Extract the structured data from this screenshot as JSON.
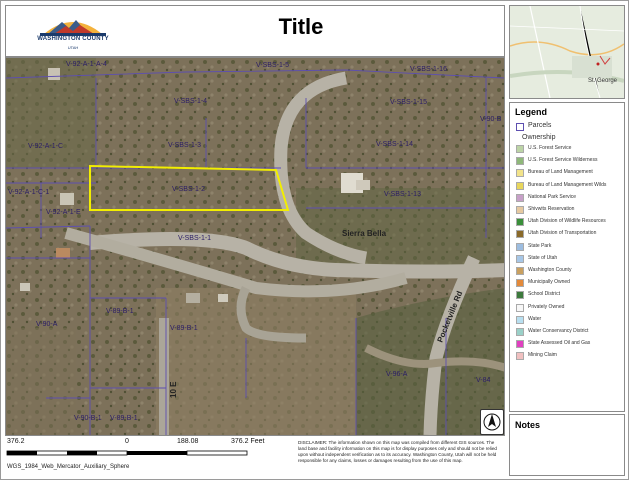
{
  "header": {
    "title": "Title",
    "logo_name": "WASHINGTON COUNTY",
    "logo_sub": "UTAH"
  },
  "map": {
    "parcel_labels": [
      {
        "id": "p1",
        "text": "V-92-A-1-A-4"
      },
      {
        "id": "p2",
        "text": "V-SBS-1-5"
      },
      {
        "id": "p3",
        "text": "V-SBS-1-16"
      },
      {
        "id": "p4",
        "text": "V-SBS-1-4"
      },
      {
        "id": "p5",
        "text": "V-SBS-1-15"
      },
      {
        "id": "p6",
        "text": "V-90-B"
      },
      {
        "id": "p7",
        "text": "V-92-A-1-C"
      },
      {
        "id": "p8",
        "text": "V-SBS-1-3"
      },
      {
        "id": "p9",
        "text": "V-SBS-1-14"
      },
      {
        "id": "p10",
        "text": "V-92-A-1-C-1"
      },
      {
        "id": "p11",
        "text": "V-SBS-1-2"
      },
      {
        "id": "p12",
        "text": "V-SBS-1-13"
      },
      {
        "id": "p13",
        "text": "V-92-A-1-E"
      },
      {
        "id": "p14",
        "text": "V-SBS-1-1"
      },
      {
        "id": "p15",
        "text": "V-89-B-1"
      },
      {
        "id": "p16",
        "text": "V-89-B-1"
      },
      {
        "id": "p17",
        "text": "V-90-A"
      },
      {
        "id": "p18",
        "text": "V-96-A"
      },
      {
        "id": "p19",
        "text": "V-84"
      },
      {
        "id": "p20",
        "text": "V-90-B-1"
      },
      {
        "id": "p21",
        "text": "V-89-B-1"
      }
    ],
    "road_labels": {
      "sierra_bella": "Sierra Bella",
      "pocketville": "Pocketville Rd",
      "tenth_east": "10 E"
    },
    "north_symbol": "north-arrow"
  },
  "overview": {
    "city_label": "St. George"
  },
  "legend": {
    "title": "Legend",
    "parcels_label": "Parcels",
    "ownership_label": "Ownership",
    "items": [
      {
        "label": "U.S. Forest Service",
        "color": "#bcd4a6"
      },
      {
        "label": "U.S. Forest Service Wilderness",
        "color": "#8fb87a"
      },
      {
        "label": "Bureau of Land Management",
        "color": "#f2e38a"
      },
      {
        "label": "Bureau of Land Management Wilds",
        "color": "#e8d65c"
      },
      {
        "label": "National Park Service",
        "color": "#c7a0c8"
      },
      {
        "label": "Shivwits Reservation",
        "color": "#e6c9a0"
      },
      {
        "label": "Utah Division of Wildlife Resources",
        "color": "#3a8f3a"
      },
      {
        "label": "Utah Division of Transportation",
        "color": "#8a6a2a"
      },
      {
        "label": "State Park",
        "color": "#9dbde0"
      },
      {
        "label": "State of Utah",
        "color": "#a7c7e7"
      },
      {
        "label": "Washington County",
        "color": "#c9a060"
      },
      {
        "label": "Municipally Owned",
        "color": "#e38a3a"
      },
      {
        "label": "School District",
        "color": "#3d7a3d"
      },
      {
        "label": "Privately Owned",
        "color": "#f7f7f7"
      },
      {
        "label": "Water",
        "color": "#b8dff0"
      },
      {
        "label": "Water Conservancy District",
        "color": "#9ad0c8"
      },
      {
        "label": "State Assessed Oil and Gas",
        "color": "#e040c0"
      },
      {
        "label": "Mining Claim",
        "color": "#f0c0c0"
      }
    ]
  },
  "notes": {
    "title": "Notes"
  },
  "scale": {
    "left": "376.2",
    "zero": "0",
    "mid": "188.08",
    "right": "376.2 Feet"
  },
  "crs": "WGS_1984_Web_Mercator_Auxiliary_Sphere",
  "disclaimer": "DISCLAIMER: The information shown on this map was compiled from different GIS sources. The land base and facility information on this map is for display purposes only and should not be relied upon without independent verification as to its accuracy. Washington County, Utah will not be held responsible for any claims, losses or damages resulting from the use of this map."
}
